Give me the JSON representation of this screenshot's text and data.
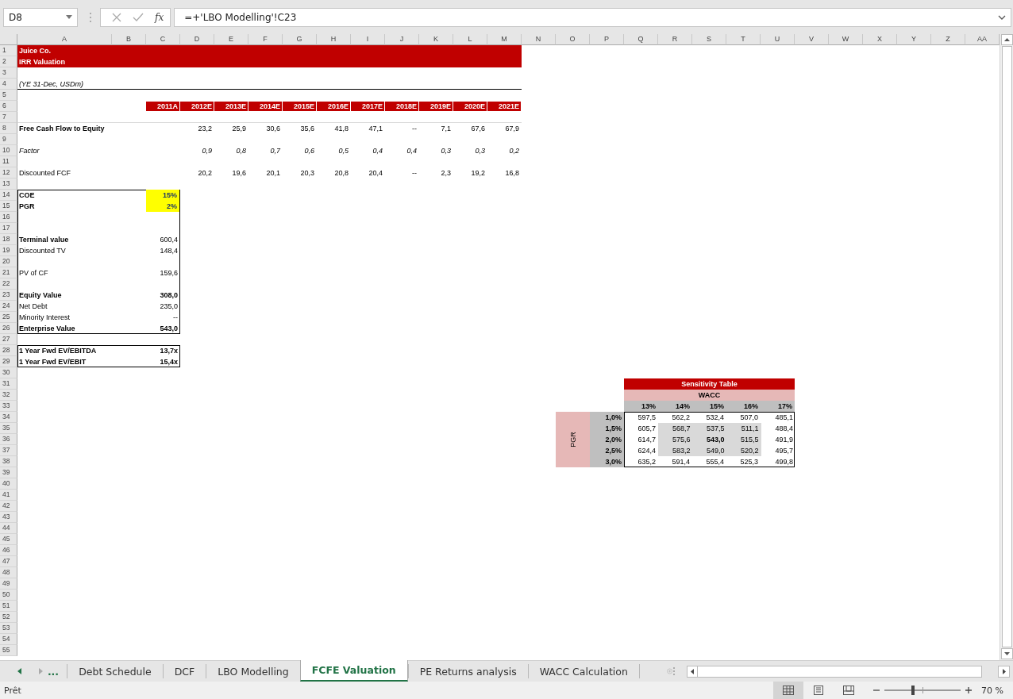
{
  "formula_bar": {
    "name_box": "D8",
    "function_label": "fx",
    "formula": "=+'LBO Modelling'!C23"
  },
  "columns": [
    "A",
    "B",
    "C",
    "D",
    "E",
    "F",
    "G",
    "H",
    "I",
    "J",
    "K",
    "L",
    "M",
    "N",
    "O",
    "P",
    "Q",
    "R",
    "S",
    "T",
    "U",
    "V",
    "W",
    "X",
    "Y",
    "Z",
    "AA"
  ],
  "rows": [
    "1",
    "2",
    "3",
    "4",
    "5",
    "6",
    "7",
    "8",
    "9",
    "10",
    "11",
    "12",
    "13",
    "14",
    "15",
    "16",
    "17",
    "18",
    "19",
    "20",
    "21",
    "22",
    "23",
    "24",
    "25",
    "26",
    "27",
    "28",
    "29",
    "30",
    "31",
    "32",
    "33",
    "34",
    "35",
    "36",
    "37",
    "38",
    "39",
    "40",
    "41",
    "42",
    "43",
    "44",
    "45",
    "46",
    "47",
    "48",
    "49",
    "50",
    "51",
    "52",
    "53",
    "54",
    "55"
  ],
  "title_block": {
    "lines": [
      "Juice Co.",
      "IRR Valuation"
    ],
    "units": "(YE 31-Dec, USDm)"
  },
  "years": [
    "2011A",
    "2012E",
    "2013E",
    "2014E",
    "2015E",
    "2016E",
    "2017E",
    "2018E",
    "2019E",
    "2020E",
    "2021E"
  ],
  "projection_rows": [
    {
      "label": "Free Cash Flow to Equity",
      "kind": "bold",
      "values": [
        "23,2",
        "25,9",
        "30,6",
        "35,6",
        "41,8",
        "47,1",
        "--",
        "7,1",
        "67,6",
        "67,9"
      ]
    },
    {
      "label": "Factor",
      "kind": "italic",
      "values": [
        "0,9",
        "0,8",
        "0,7",
        "0,6",
        "0,5",
        "0,4",
        "0,4",
        "0,3",
        "0,3",
        "0,2"
      ]
    },
    {
      "label": "Discounted FCF",
      "kind": "plain",
      "values": [
        "20,2",
        "19,6",
        "20,1",
        "20,3",
        "20,8",
        "20,4",
        "--",
        "2,3",
        "19,2",
        "16,8"
      ]
    }
  ],
  "valuation": [
    {
      "label": "COE",
      "value": "15%",
      "kind": "input"
    },
    {
      "label": "PGR",
      "value": "2%",
      "kind": "input"
    },
    {
      "label": "Terminal value",
      "value": "600,4",
      "kind": "bold-label"
    },
    {
      "label": "Discounted TV",
      "value": "148,4",
      "kind": "plain"
    },
    {
      "label": "PV of CF",
      "value": "159,6",
      "kind": "plain"
    },
    {
      "label": "Equity Value",
      "value": "308,0",
      "kind": "bold"
    },
    {
      "label": "Net Debt",
      "value": "235,0",
      "kind": "plain"
    },
    {
      "label": "Minority Interest",
      "value": "--",
      "kind": "plain"
    },
    {
      "label": "Enterprise Value",
      "value": "543,0",
      "kind": "bold"
    }
  ],
  "multiples": [
    {
      "label": "1 Year Fwd EV/EBITDA",
      "value": "13,7x"
    },
    {
      "label": "1 Year Fwd EV/EBIT",
      "value": "15,4x"
    }
  ],
  "sensitivity_table": {
    "title": "Sensitivity Table",
    "column_axis": "WACC",
    "row_axis": "PGR",
    "columns": [
      "13%",
      "14%",
      "15%",
      "16%",
      "17%"
    ],
    "rows": [
      {
        "label": "1,0%",
        "cells": [
          {
            "value": "597,5",
            "shaded": false,
            "bold": false
          },
          {
            "value": "562,2",
            "shaded": false,
            "bold": false
          },
          {
            "value": "532,4",
            "shaded": false,
            "bold": false
          },
          {
            "value": "507,0",
            "shaded": false,
            "bold": false
          },
          {
            "value": "485,1",
            "shaded": false,
            "bold": false
          }
        ]
      },
      {
        "label": "1,5%",
        "cells": [
          {
            "value": "605,7",
            "shaded": false,
            "bold": false
          },
          {
            "value": "568,7",
            "shaded": true,
            "bold": false
          },
          {
            "value": "537,5",
            "shaded": true,
            "bold": false
          },
          {
            "value": "511,1",
            "shaded": true,
            "bold": false
          },
          {
            "value": "488,4",
            "shaded": false,
            "bold": false
          }
        ]
      },
      {
        "label": "2,0%",
        "cells": [
          {
            "value": "614,7",
            "shaded": false,
            "bold": false
          },
          {
            "value": "575,6",
            "shaded": true,
            "bold": false
          },
          {
            "value": "543,0",
            "shaded": true,
            "bold": true
          },
          {
            "value": "515,5",
            "shaded": true,
            "bold": false
          },
          {
            "value": "491,9",
            "shaded": false,
            "bold": false
          }
        ]
      },
      {
        "label": "2,5%",
        "cells": [
          {
            "value": "624,4",
            "shaded": false,
            "bold": false
          },
          {
            "value": "583,2",
            "shaded": true,
            "bold": false
          },
          {
            "value": "549,0",
            "shaded": true,
            "bold": false
          },
          {
            "value": "520,2",
            "shaded": true,
            "bold": false
          },
          {
            "value": "495,7",
            "shaded": false,
            "bold": false
          }
        ]
      },
      {
        "label": "3,0%",
        "cells": [
          {
            "value": "635,2",
            "shaded": false,
            "bold": false
          },
          {
            "value": "591,4",
            "shaded": false,
            "bold": false
          },
          {
            "value": "555,4",
            "shaded": false,
            "bold": false
          },
          {
            "value": "525,3",
            "shaded": false,
            "bold": false
          },
          {
            "value": "499,8",
            "shaded": false,
            "bold": false
          }
        ]
      }
    ]
  },
  "sheet_tabs": {
    "more": "...",
    "tabs": [
      {
        "label": "Debt Schedule",
        "selected": false
      },
      {
        "label": "DCF",
        "selected": false
      },
      {
        "label": "LBO Modelling",
        "selected": false
      },
      {
        "label": "FCFE Valuation",
        "selected": true
      },
      {
        "label": "PE Returns analysis",
        "selected": false
      },
      {
        "label": "WACC Calculation",
        "selected": false
      }
    ]
  },
  "status_bar": {
    "status": "Prêt",
    "views": [
      {
        "kind": "normal",
        "selected": true
      },
      {
        "kind": "page-layout",
        "selected": false
      },
      {
        "kind": "page-break",
        "selected": false
      }
    ],
    "zoom": {
      "level": 0.37,
      "reading": "70 %"
    }
  }
}
